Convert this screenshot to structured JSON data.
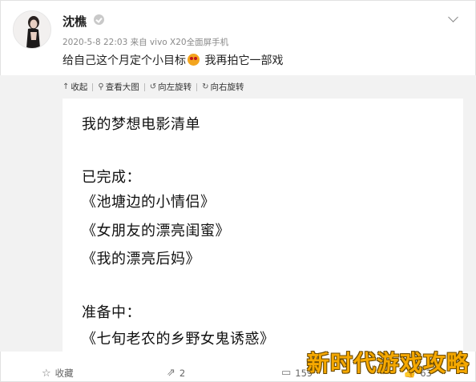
{
  "post": {
    "user_name": "沈樵",
    "meta": "2020-5-8 22:03 来自 vivo X20全面屏手机",
    "text_before_emoji": "给自己这个月定个小目标",
    "emoji": "smiling-face-with-heart-eyes",
    "text_after_emoji": "我再拍它一部戏"
  },
  "toolbar": {
    "collapse": "收起",
    "view_large": "查看大图",
    "rotate_left": "向左旋转",
    "rotate_right": "向右旋转"
  },
  "image": {
    "lines": [
      "我的梦想电影清单",
      "已完成：",
      "《池塘边的小情侣》",
      "《女朋友的漂亮闺蜜》",
      "《我的漂亮后妈》",
      "准备中：",
      "《七旬老农的乡野女鬼诱惑》"
    ]
  },
  "footer": {
    "favorite": "收藏",
    "repost_count": "2",
    "comment_count": "159",
    "like_count": "63"
  },
  "overlay": {
    "brand": "新时代游戏攻略"
  },
  "colors": {
    "brand_overlay": "#f5a800",
    "media_bg": "#f2f2f2"
  }
}
